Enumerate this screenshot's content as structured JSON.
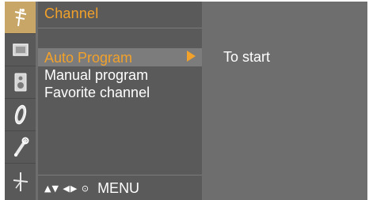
{
  "rail": {
    "items": [
      {
        "icon": "antenna-icon",
        "active": true
      },
      {
        "icon": "picture-icon",
        "active": false
      },
      {
        "icon": "speaker-icon",
        "active": false
      },
      {
        "icon": "clock-icon",
        "active": false
      },
      {
        "icon": "tools-icon",
        "active": false
      },
      {
        "icon": "input-icon",
        "active": false
      }
    ]
  },
  "menu": {
    "title": "Channel",
    "items": [
      {
        "label": "Auto Program",
        "selected": true
      },
      {
        "label": "Manual program",
        "selected": false
      },
      {
        "label": "Favorite channel",
        "selected": false
      }
    ],
    "footer": {
      "nav_glyphs": "▲▼ ◀▶ ⊙",
      "menu_label": "MENU"
    }
  },
  "info": {
    "text": "To start"
  },
  "colors": {
    "accent": "#f2a12a",
    "background": "#6e6e6e",
    "panel": "#5a5a5a",
    "rail_active": "#c8a668"
  }
}
